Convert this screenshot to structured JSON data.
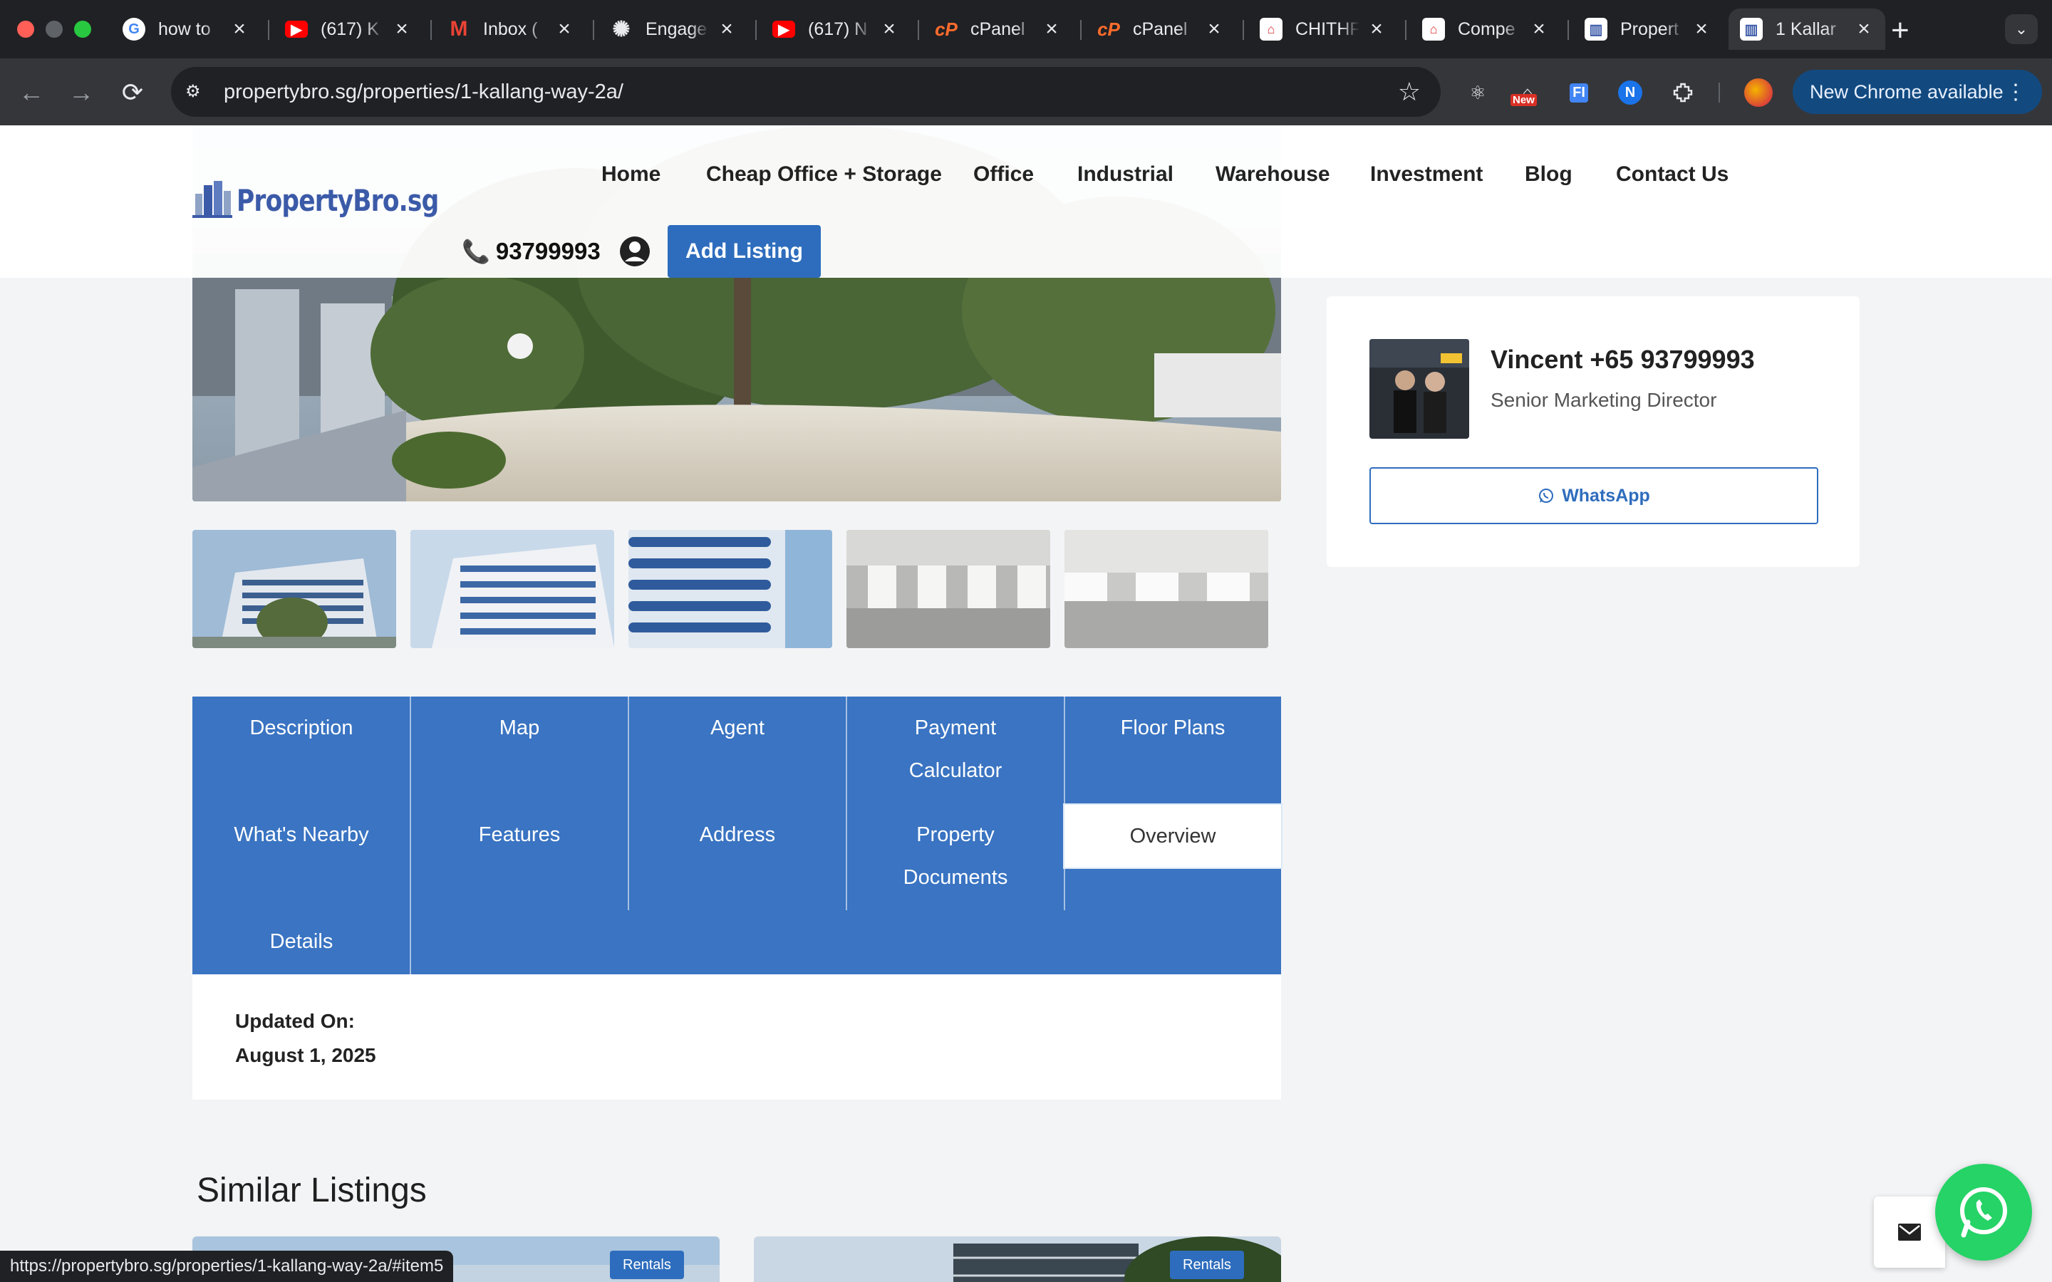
{
  "browser": {
    "tabs": [
      {
        "title": "how to",
        "icon": "google-icon",
        "color": "#ffffff"
      },
      {
        "title": "(617) K",
        "icon": "youtube-icon",
        "color": "#ff0000"
      },
      {
        "title": "Inbox (",
        "icon": "gmail-icon",
        "color": "#ffffff"
      },
      {
        "title": "Engage",
        "icon": "openai-icon",
        "color": "#202124"
      },
      {
        "title": "(617) N",
        "icon": "youtube-icon",
        "color": "#ff0000"
      },
      {
        "title": "cPanel",
        "icon": "cpanel-icon",
        "color": "#ff6c2c"
      },
      {
        "title": "cPanel",
        "icon": "cpanel-icon",
        "color": "#ff6c2c"
      },
      {
        "title": "CHITHF",
        "icon": "chith-icon",
        "color": "#ffffff"
      },
      {
        "title": "Compe",
        "icon": "compe-icon",
        "color": "#ffffff"
      },
      {
        "title": "Propert",
        "icon": "propertybro-icon",
        "color": "#ffffff"
      },
      {
        "title": "1 Kallar",
        "icon": "propertybro-icon",
        "color": "#ffffff"
      }
    ],
    "url": "propertybro.sg/properties/1-kallang-way-2a/",
    "update_label": "New Chrome available",
    "new_badge": "New",
    "status_url": "https://propertybro.sg/properties/1-kallang-way-2a/#item5"
  },
  "site": {
    "logo_text": "PropertyBro.sg",
    "nav": [
      "Home",
      "Cheap Office + Storage",
      "Office",
      "Industrial",
      "Warehouse",
      "Investment",
      "Blog",
      "Contact Us"
    ],
    "phone": "93799993",
    "add_listing": "Add Listing",
    "accent": "#2e6dbd"
  },
  "tabs": {
    "description": "Description",
    "map": "Map",
    "agent": "Agent",
    "payment": "Payment Calculator",
    "floor_plans": "Floor Plans",
    "nearby": "What's Nearby",
    "features": "Features",
    "address": "Address",
    "documents": "Property Documents",
    "overview": "Overview",
    "details": "Details"
  },
  "overview": {
    "updated_label": "Updated On:",
    "updated_date": "August 1, 2025"
  },
  "similar": {
    "title": "Similar Listings",
    "badge_1": "Rentals",
    "badge_2": "Rentals"
  },
  "agent": {
    "name": "Vincent +65 93799993",
    "role": "Senior Marketing Director",
    "whatsapp": "WhatsApp"
  }
}
